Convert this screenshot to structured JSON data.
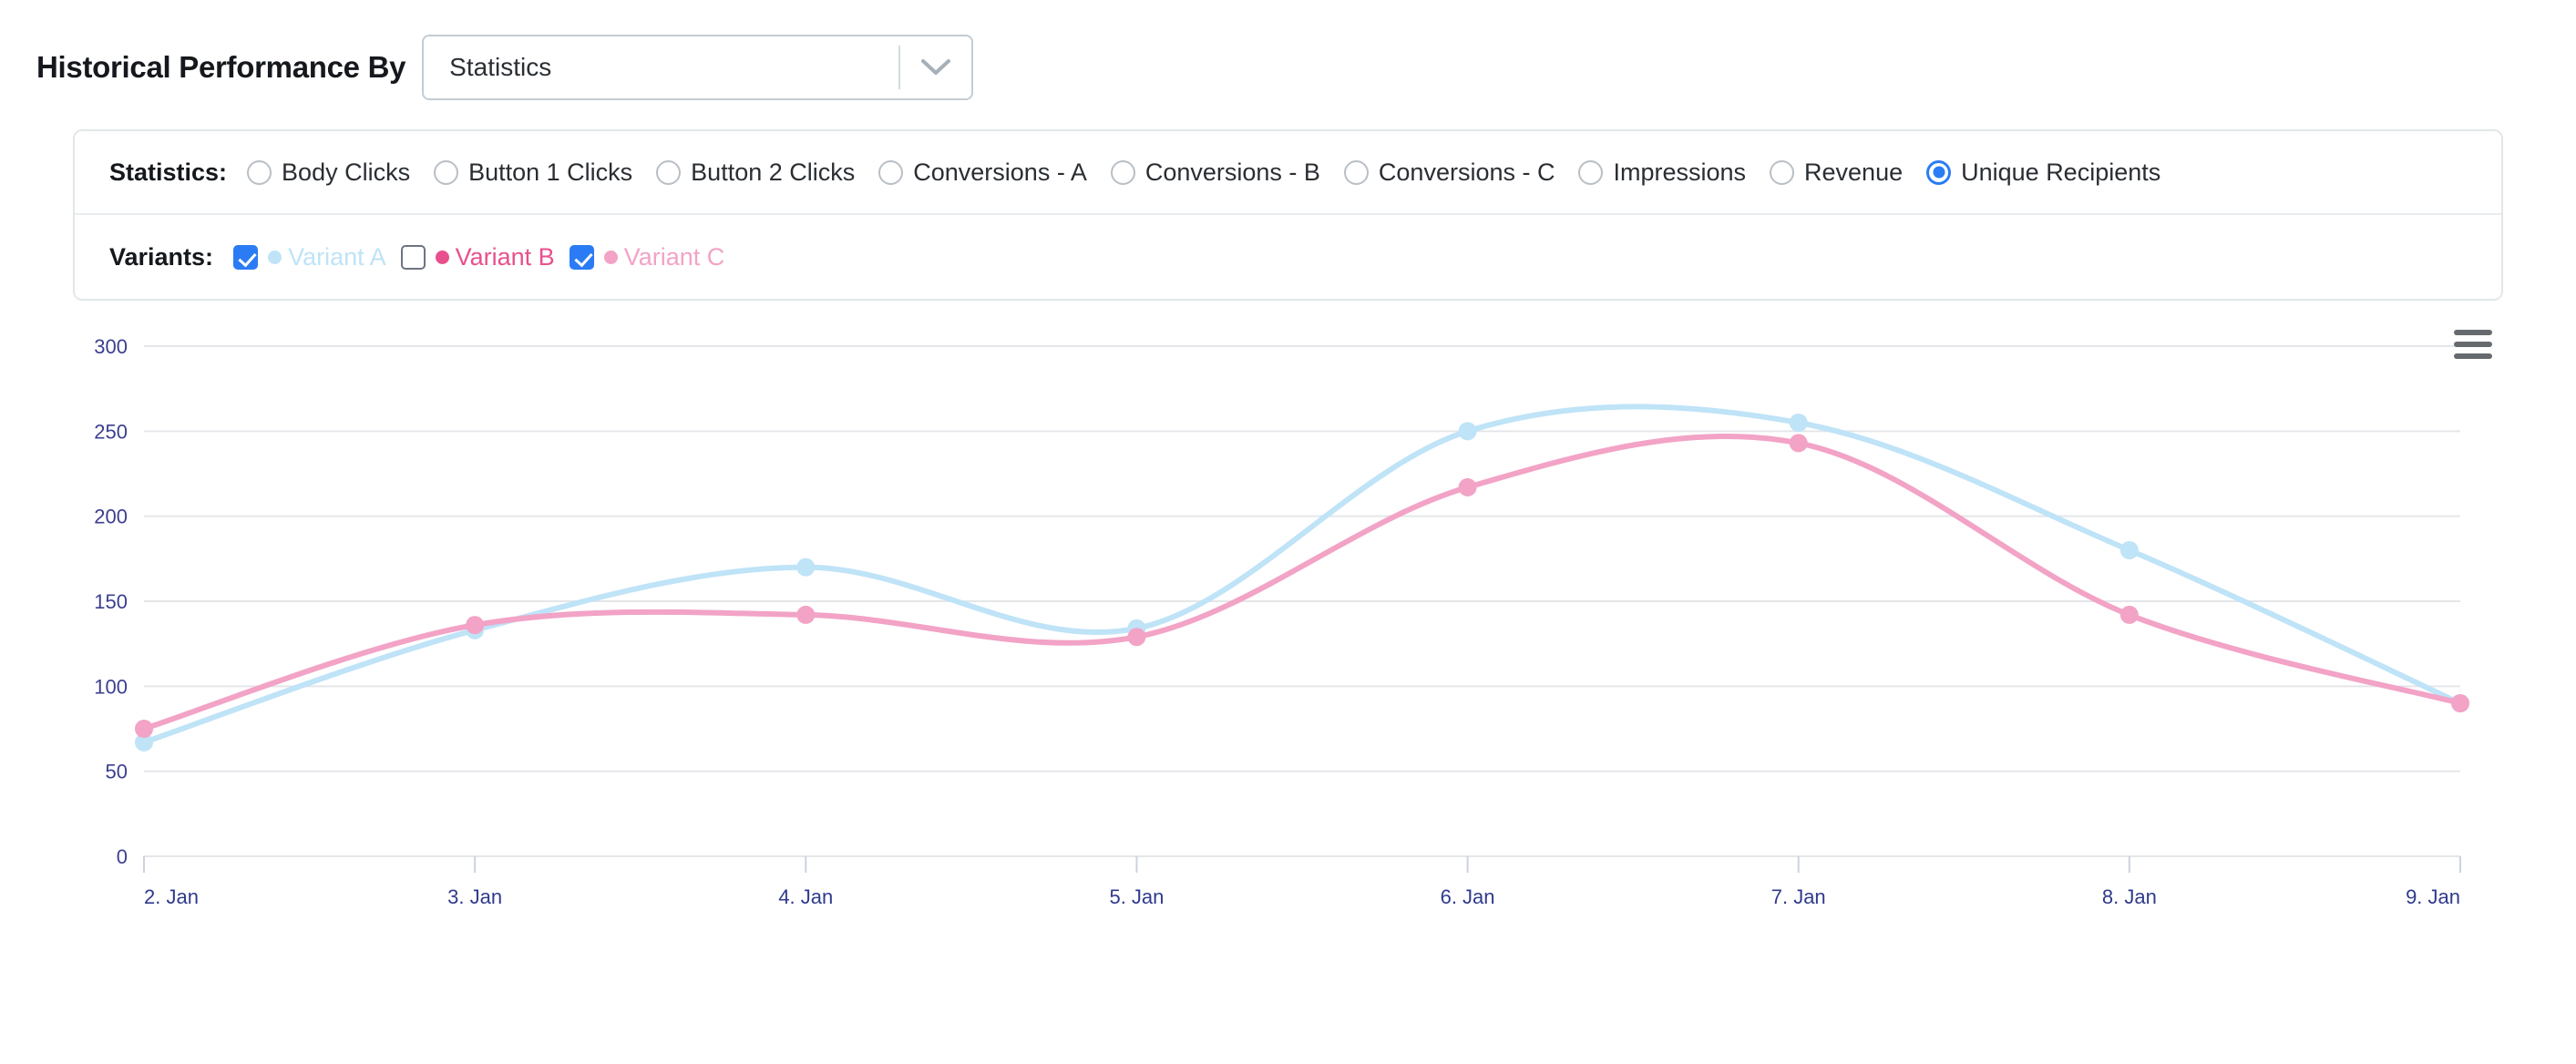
{
  "header": {
    "title": "Historical Performance By",
    "select": {
      "name": "statistics-select",
      "value": "Statistics",
      "placeholder": "Statistics",
      "arrow_icon": "chevron-down-icon"
    }
  },
  "filters": {
    "statistics": {
      "label": "Statistics:",
      "selected": "Unique Recipients",
      "options": [
        {
          "label": "Body Clicks",
          "checked": false
        },
        {
          "label": "Button 1 Clicks",
          "checked": false
        },
        {
          "label": "Button 2 Clicks",
          "checked": false
        },
        {
          "label": "Conversions - A",
          "checked": false
        },
        {
          "label": "Conversions - B",
          "checked": false
        },
        {
          "label": "Conversions - C",
          "checked": false
        },
        {
          "label": "Impressions",
          "checked": false
        },
        {
          "label": "Revenue",
          "checked": false
        },
        {
          "label": "Unique Recipients",
          "checked": true
        }
      ]
    },
    "variants": {
      "label": "Variants:",
      "options": [
        {
          "label": "Variant A",
          "checked": true,
          "color": "#bfe3f7"
        },
        {
          "label": "Variant B",
          "checked": false,
          "color": "#e8508d"
        },
        {
          "label": "Variant C",
          "checked": true,
          "color": "#f2a3c6"
        }
      ]
    }
  },
  "chart_toolbar": {
    "export_icon": "hamburger-menu-icon"
  },
  "chart_data": {
    "type": "line",
    "title": "",
    "subtitle": "",
    "xlabel": "",
    "ylabel": "",
    "x": [
      "2. Jan",
      "3. Jan",
      "4. Jan",
      "5. Jan",
      "6. Jan",
      "7. Jan",
      "8. Jan",
      "9. Jan"
    ],
    "xtick_labels": [
      "2. Jan",
      "3. Jan",
      "4. Jan",
      "5. Jan",
      "6. Jan",
      "7. Jan",
      "8. Jan",
      "9. Jan"
    ],
    "ytick_labels": [
      "0",
      "50",
      "100",
      "150",
      "200",
      "250",
      "300"
    ],
    "yticks": [
      0,
      50,
      100,
      150,
      200,
      250,
      300
    ],
    "ylim": [
      0,
      300
    ],
    "grid": true,
    "legend_position": "none",
    "series": [
      {
        "name": "Variant A",
        "color": "#bfe3f7",
        "visible": true,
        "values": [
          67,
          133,
          170,
          134,
          250,
          255,
          180,
          90
        ]
      },
      {
        "name": "Variant B",
        "color": "#e8508d",
        "visible": false,
        "values": []
      },
      {
        "name": "Variant C",
        "color": "#f2a3c6",
        "visible": true,
        "values": [
          75,
          136,
          142,
          129,
          217,
          243,
          142,
          90
        ]
      }
    ]
  }
}
